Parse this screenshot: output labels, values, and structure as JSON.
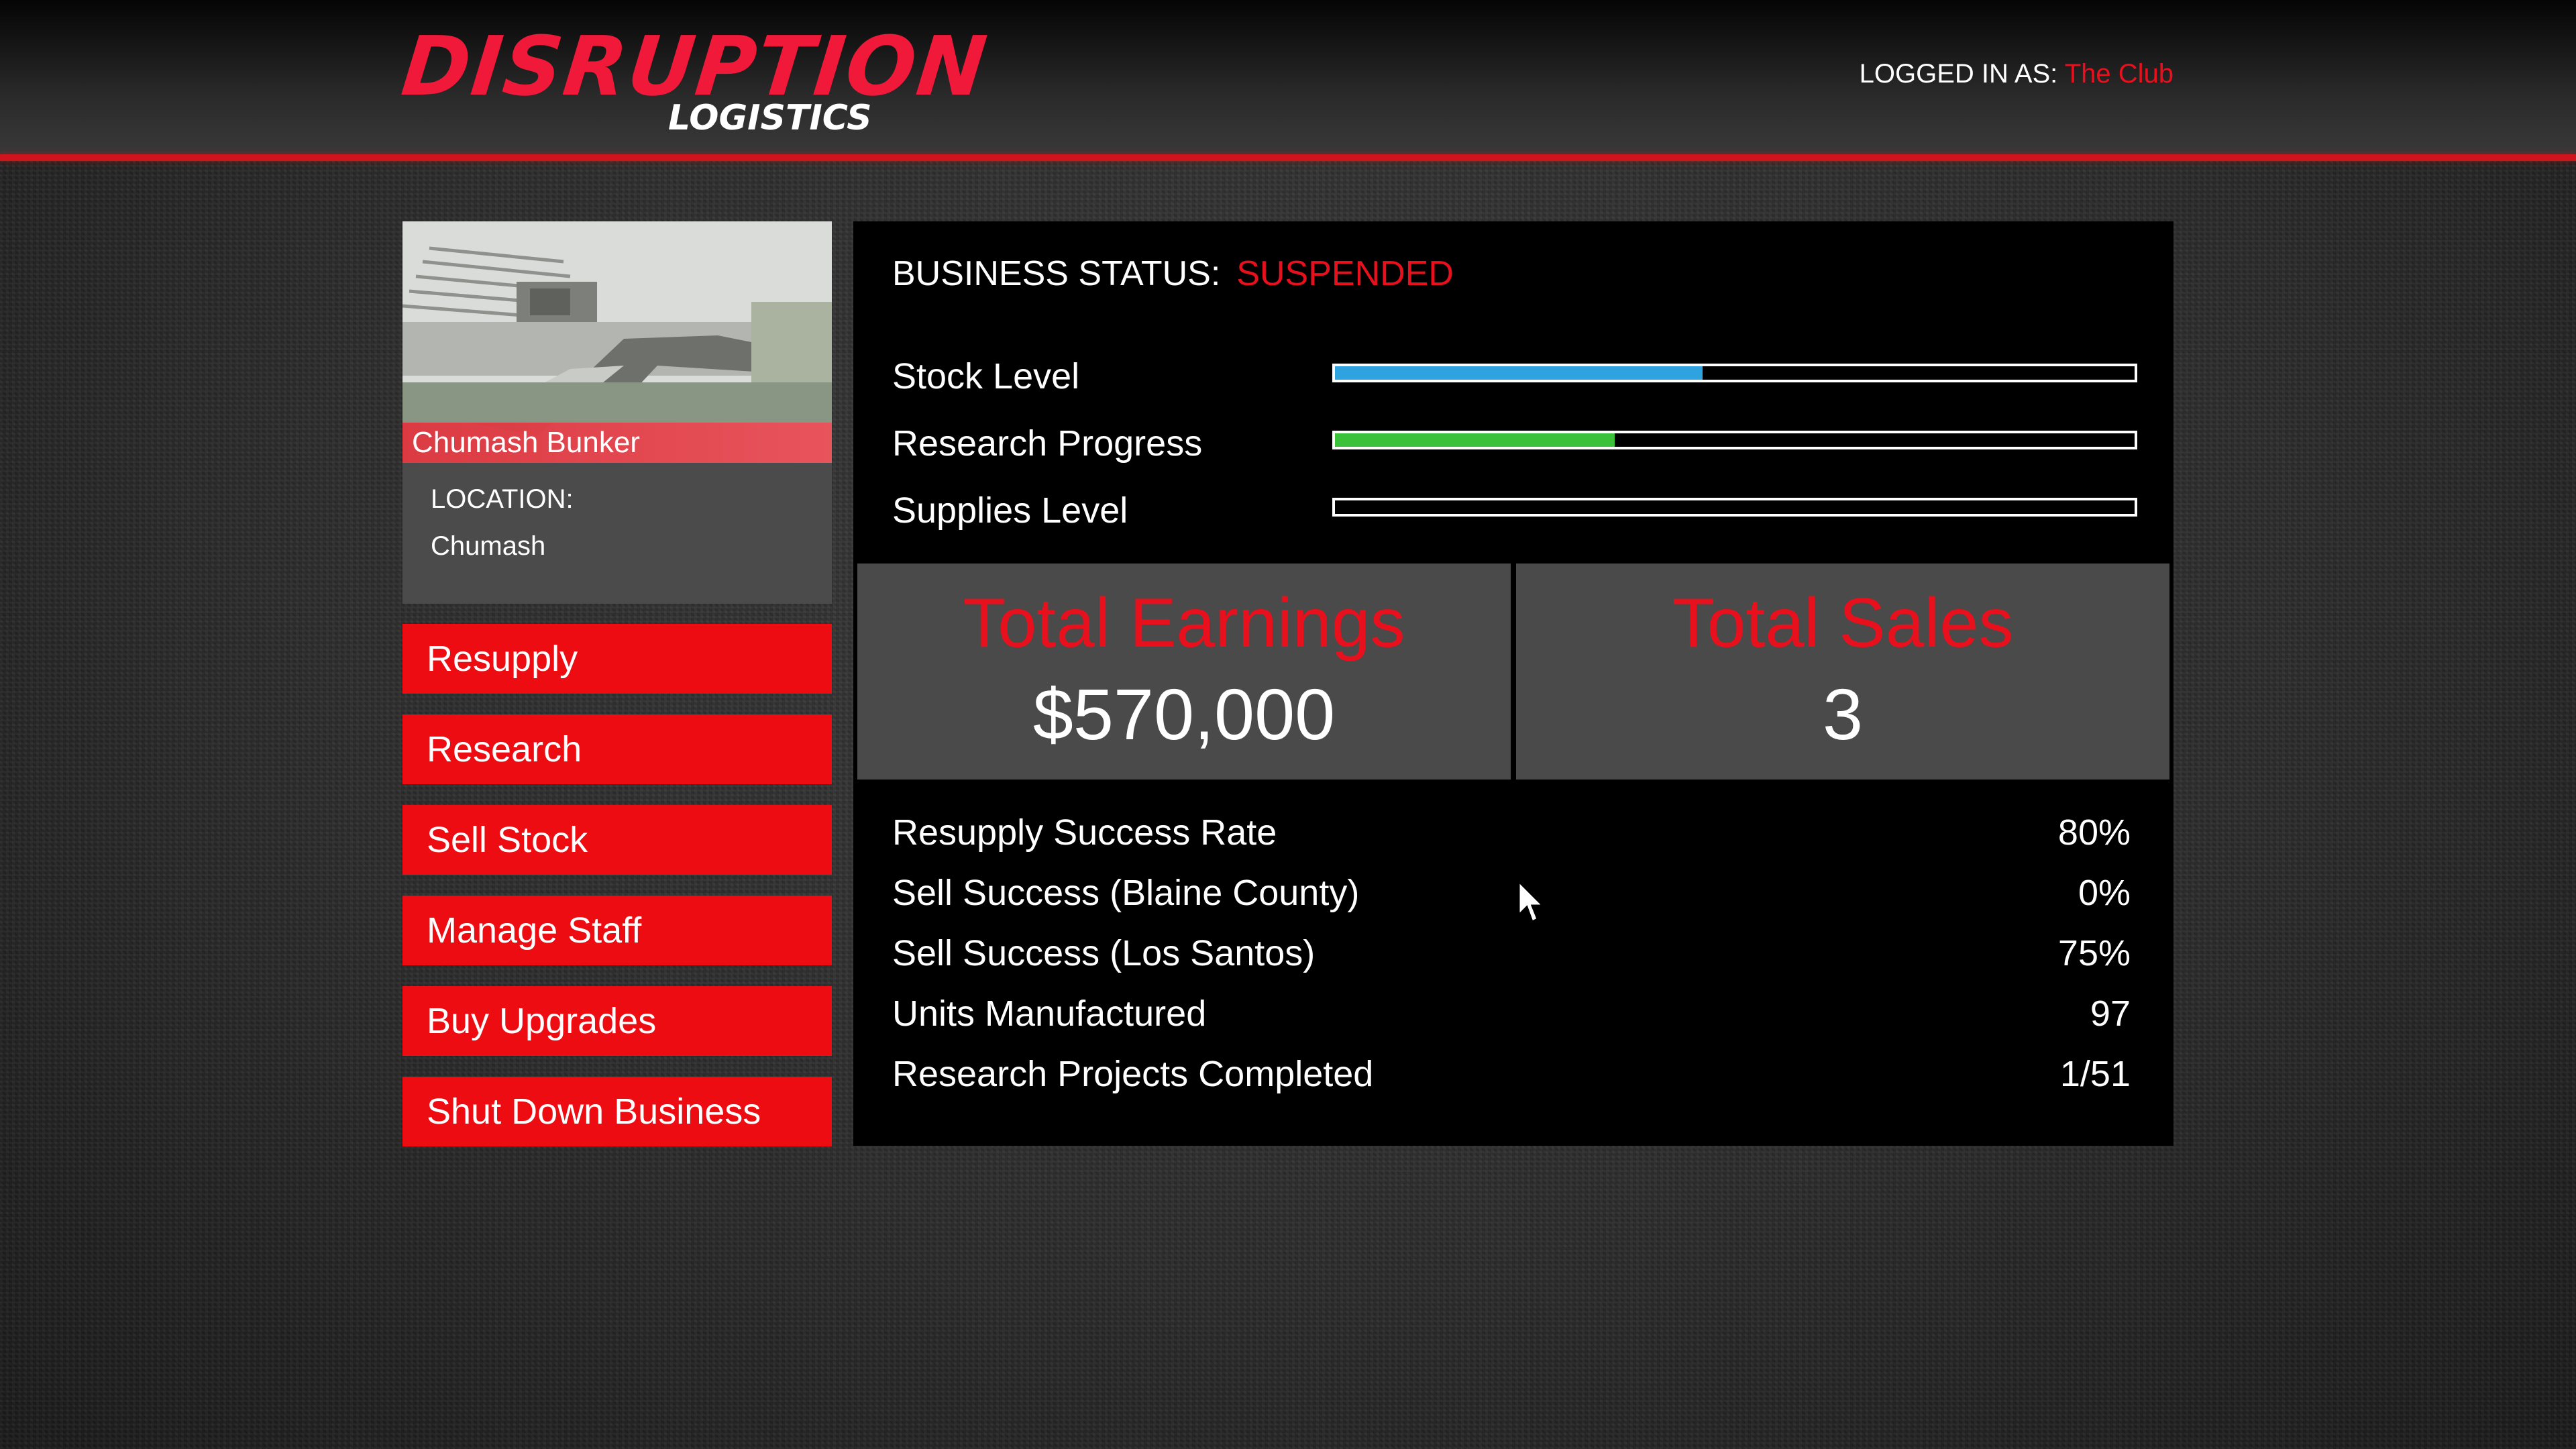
{
  "header": {
    "logo_main": "DISRUPTION",
    "logo_sub": "LOGISTICS",
    "login_label": "LOGGED IN AS:",
    "login_user": "The Club"
  },
  "business": {
    "name": "Chumash Bunker",
    "location_label": "LOCATION:",
    "location_value": "Chumash"
  },
  "menu": [
    {
      "label": "Resupply"
    },
    {
      "label": "Research"
    },
    {
      "label": "Sell Stock"
    },
    {
      "label": "Manage Staff"
    },
    {
      "label": "Buy Upgrades"
    },
    {
      "label": "Shut Down Business"
    }
  ],
  "status": {
    "label": "BUSINESS STATUS:",
    "value": "SUSPENDED"
  },
  "bars": [
    {
      "label": "Stock Level",
      "fraction": 0.46,
      "color": "#2fa3e0"
    },
    {
      "label": "Research Progress",
      "fraction": 0.35,
      "color": "#3cc23a"
    },
    {
      "label": "Supplies Level",
      "fraction": 0.0,
      "color": "#ffffff"
    }
  ],
  "totals": {
    "earnings_label": "Total Earnings",
    "earnings_value": "$570,000",
    "sales_label": "Total Sales",
    "sales_value": "3"
  },
  "metrics": [
    {
      "label": "Resupply Success Rate",
      "value": "80%"
    },
    {
      "label": "Sell Success (Blaine County)",
      "value": "0%"
    },
    {
      "label": "Sell Success (Los Santos)",
      "value": "75%"
    },
    {
      "label": "Units Manufactured",
      "value": "97"
    },
    {
      "label": "Research Projects Completed",
      "value": "1/51"
    }
  ],
  "colors": {
    "accent_red": "#ee0c13",
    "panel_black": "#000000",
    "stat_box_gray": "#4a4a4a"
  }
}
